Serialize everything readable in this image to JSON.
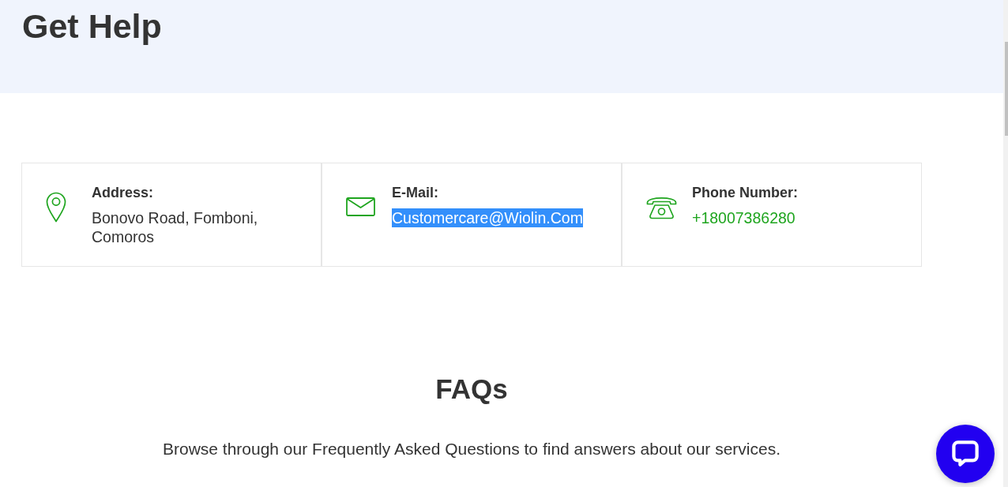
{
  "header": {
    "title": "Get Help"
  },
  "contacts": [
    {
      "kind": "address",
      "label": "Address:",
      "value": "Bonovo Road, Fomboni, Comoros",
      "selected": false
    },
    {
      "kind": "email",
      "label": "E-Mail:",
      "value": "Customercare@Wiolin.Com",
      "selected": true
    },
    {
      "kind": "phone",
      "label": "Phone Number:",
      "value": "+18007386280",
      "selected": false
    }
  ],
  "faqs": {
    "title": "FAQs",
    "description": "Browse through our Frequently Asked Questions to find answers about our services."
  }
}
